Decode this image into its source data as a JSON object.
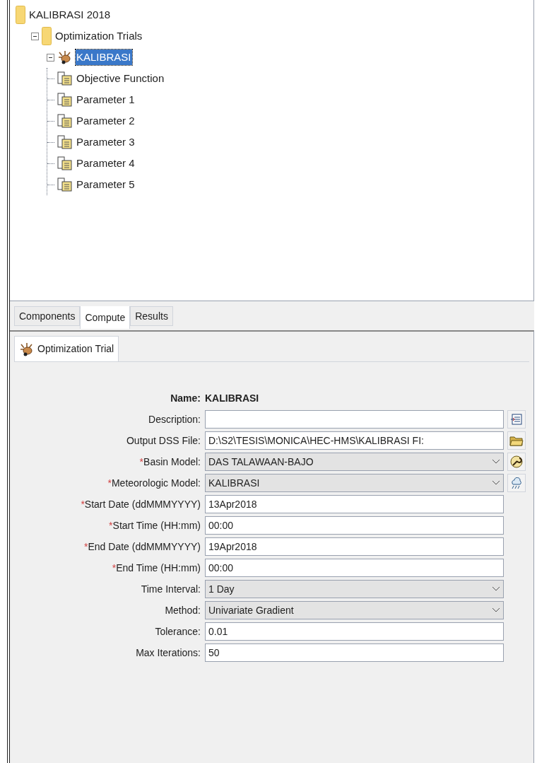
{
  "tree": [
    {
      "label": "KALIBRASI 2018",
      "kind": "folder",
      "selected": false,
      "children": [
        {
          "label": "Optimization Trials",
          "kind": "folder",
          "selected": false,
          "expanded": true,
          "children": [
            {
              "label": "KALIBRASI",
              "kind": "trial",
              "selected": true,
              "expanded": true,
              "children": [
                {
                  "label": "Objective Function",
                  "kind": "sheet",
                  "selected": false
                },
                {
                  "label": "Parameter 1",
                  "kind": "sheet",
                  "selected": false
                },
                {
                  "label": "Parameter 2",
                  "kind": "sheet",
                  "selected": false
                },
                {
                  "label": "Parameter 3",
                  "kind": "sheet",
                  "selected": false
                },
                {
                  "label": "Parameter 4",
                  "kind": "sheet",
                  "selected": false
                },
                {
                  "label": "Parameter 5",
                  "kind": "sheet",
                  "selected": false
                }
              ]
            }
          ]
        }
      ]
    }
  ],
  "tabs": [
    {
      "label": "Components",
      "selected": false
    },
    {
      "label": "Compute",
      "selected": true
    },
    {
      "label": "Results",
      "selected": false
    }
  ],
  "editor": {
    "tab": {
      "label": "Optimization Trial",
      "selected": true
    },
    "name": {
      "label": "Name:",
      "value": "KALIBRASI"
    },
    "fields": [
      {
        "label": "Description:",
        "kind": "text",
        "button": {
          "kind": "notes"
        }
      },
      {
        "label": "Output DSS File:",
        "kind": "text",
        "value": "D:\\S2\\TESIS\\MONICA\\HEC-HMS\\KALIBRASI FI:",
        "button": {
          "kind": "folder"
        }
      },
      {
        "marker": "*",
        "label": "Basin Model:",
        "kind": "combo",
        "value": "DAS TALAWAAN-BAJO",
        "button": {
          "kind": "wrench"
        }
      },
      {
        "marker": "*",
        "label": "Meteorologic Model:",
        "kind": "combo",
        "value": "KALIBRASI",
        "button": {
          "kind": "weather"
        }
      },
      {
        "marker": "*",
        "label": "Start Date (ddMMMYYYY)",
        "kind": "text",
        "value": "13Apr2018"
      },
      {
        "marker": "*",
        "label": "Start Time (HH:mm)",
        "kind": "text",
        "value": "00:00"
      },
      {
        "marker": "*",
        "label": "End Date (ddMMMYYYY)",
        "kind": "text",
        "value": "19Apr2018"
      },
      {
        "marker": "*",
        "label": "End Time (HH:mm)",
        "kind": "text",
        "value": "00:00"
      },
      {
        "label": "Time Interval:",
        "kind": "combo",
        "value": "1 Day"
      },
      {
        "label": "Method:",
        "kind": "combo",
        "value": "Univariate Gradient"
      },
      {
        "label": "Tolerance:",
        "kind": "text",
        "value": "0.01"
      },
      {
        "label": "Max Iterations:",
        "kind": "text",
        "value": "50"
      }
    ]
  }
}
